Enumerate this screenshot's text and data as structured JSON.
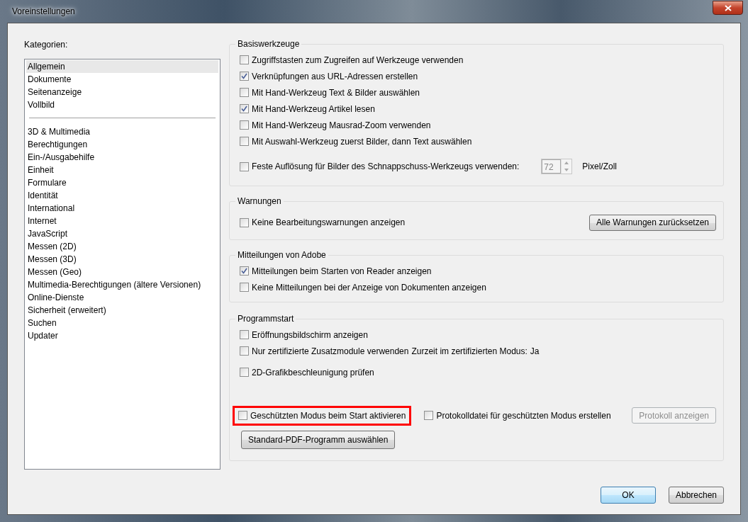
{
  "window": {
    "title": "Voreinstellungen"
  },
  "categories": {
    "label": "Kategorien:",
    "groups": [
      [
        {
          "label": "Allgemein",
          "selected": true
        },
        {
          "label": "Dokumente",
          "selected": false
        },
        {
          "label": "Seitenanzeige",
          "selected": false
        },
        {
          "label": "Vollbild",
          "selected": false
        }
      ],
      [
        {
          "label": "3D & Multimedia",
          "selected": false
        },
        {
          "label": "Berechtigungen",
          "selected": false
        },
        {
          "label": "Ein-/Ausgabehilfe",
          "selected": false
        },
        {
          "label": "Einheit",
          "selected": false
        },
        {
          "label": "Formulare",
          "selected": false
        },
        {
          "label": "Identität",
          "selected": false
        },
        {
          "label": "International",
          "selected": false
        },
        {
          "label": "Internet",
          "selected": false
        },
        {
          "label": "JavaScript",
          "selected": false
        },
        {
          "label": "Messen (2D)",
          "selected": false
        },
        {
          "label": "Messen (3D)",
          "selected": false
        },
        {
          "label": "Messen (Geo)",
          "selected": false
        },
        {
          "label": "Multimedia-Berechtigungen (ältere Versionen)",
          "selected": false
        },
        {
          "label": "Online-Dienste",
          "selected": false
        },
        {
          "label": "Sicherheit (erweitert)",
          "selected": false
        },
        {
          "label": "Suchen",
          "selected": false
        },
        {
          "label": "Updater",
          "selected": false
        }
      ]
    ]
  },
  "basiswerkzeuge": {
    "title": "Basiswerkzeuge",
    "options": [
      {
        "label": "Zugriffstasten zum Zugreifen auf Werkzeuge verwenden",
        "checked": false
      },
      {
        "label": "Verknüpfungen aus URL-Adressen erstellen",
        "checked": true
      },
      {
        "label": "Mit Hand-Werkzeug Text & Bilder auswählen",
        "checked": false
      },
      {
        "label": "Mit Hand-Werkzeug Artikel lesen",
        "checked": true
      },
      {
        "label": "Mit Hand-Werkzeug Mausrad-Zoom verwenden",
        "checked": false
      },
      {
        "label": "Mit Auswahl-Werkzeug zuerst Bilder, dann Text auswählen",
        "checked": false
      }
    ],
    "snapshot": {
      "label": "Feste Auflösung für Bilder des Schnappschuss-Werkzeugs verwenden:",
      "checked": false,
      "value": "72",
      "unit": "Pixel/Zoll"
    }
  },
  "warnungen": {
    "title": "Warnungen",
    "option": {
      "label": "Keine Bearbeitungswarnungen anzeigen",
      "checked": false
    },
    "button": "Alle Warnungen zurücksetzen"
  },
  "mitteilungen": {
    "title": "Mitteilungen von Adobe",
    "options": [
      {
        "label": "Mitteilungen beim Starten von Reader anzeigen",
        "checked": true
      },
      {
        "label": "Keine Mitteilungen bei der Anzeige von Dokumenten anzeigen",
        "checked": false
      }
    ]
  },
  "programmstart": {
    "title": "Programmstart",
    "splash": {
      "label": "Eröffnungsbildschirm anzeigen",
      "checked": false
    },
    "certified": {
      "label": "Nur zertifizierte Zusatzmodule verwenden",
      "checked": false,
      "status_label": "Zurzeit im zertifizierten Modus:",
      "status_value": "Ja"
    },
    "gpu": {
      "label": "2D-Grafikbeschleunigung prüfen",
      "checked": false
    },
    "protected": {
      "label": "Geschützten Modus beim Start aktivieren",
      "checked": false,
      "highlighted": true
    },
    "logfile": {
      "label": "Protokolldatei für geschützten Modus erstellen",
      "checked": false
    },
    "log_button": {
      "label": "Protokoll anzeigen",
      "disabled": true
    },
    "default_button": "Standard-PDF-Programm auswählen"
  },
  "buttons": [
    {
      "label": "OK",
      "kind": "default"
    },
    {
      "label": "Abbrechen",
      "kind": "normal"
    }
  ]
}
